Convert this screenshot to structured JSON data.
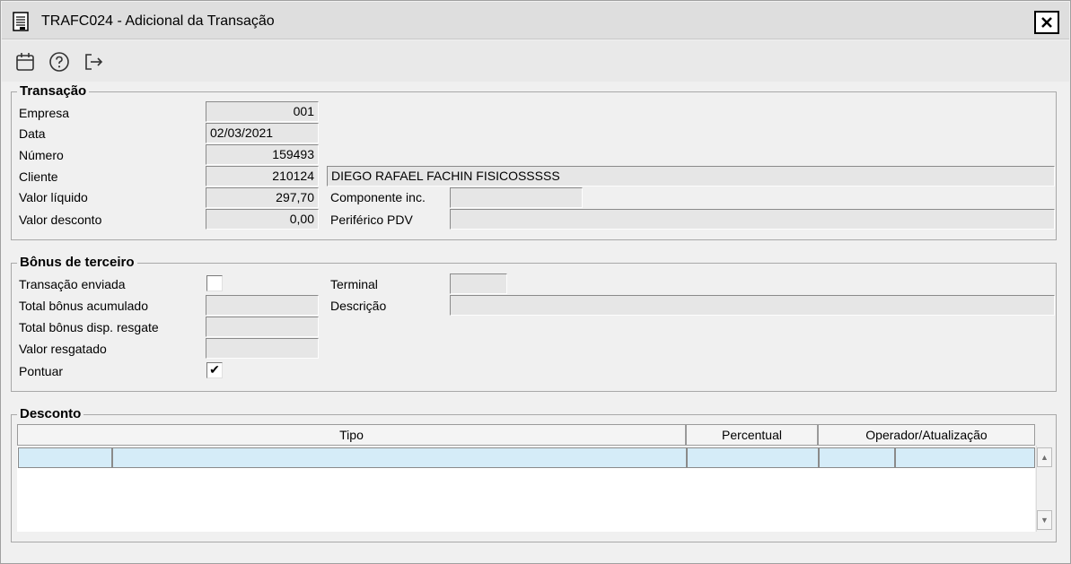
{
  "window": {
    "title": "TRAFC024 - Adicional da Transação",
    "close_label": "X"
  },
  "toolbar": {
    "icons": [
      "calendar-icon",
      "help-icon",
      "exit-icon"
    ]
  },
  "transacao": {
    "legend": "Transação",
    "empresa_label": "Empresa",
    "empresa": "001",
    "data_label": "Data",
    "data": "02/03/2021",
    "numero_label": "Número",
    "numero": "159493",
    "cliente_label": "Cliente",
    "cliente_codigo": "210124",
    "cliente_nome": "DIEGO RAFAEL FACHIN FISICOSSSSS",
    "valor_liquido_label": "Valor líquido",
    "valor_liquido": "297,70",
    "componente_label": "Componente inc.",
    "componente": "",
    "valor_desconto_label": "Valor desconto",
    "valor_desconto": "0,00",
    "periferico_label": "Periférico PDV",
    "periferico": ""
  },
  "bonus": {
    "legend": "Bônus de terceiro",
    "transacao_enviada_label": "Transação enviada",
    "transacao_enviada_checked": false,
    "terminal_label": "Terminal",
    "terminal": "",
    "total_acumulado_label": "Total bônus acumulado",
    "total_acumulado": "",
    "descricao_label": "Descrição",
    "descricao": "",
    "total_disp_label": "Total bônus disp. resgate",
    "total_disp": "",
    "valor_resgatado_label": "Valor resgatado",
    "valor_resgatado": "",
    "pontuar_label": "Pontuar",
    "pontuar_checked": true,
    "check_mark": "✔"
  },
  "desconto": {
    "legend": "Desconto",
    "columns": [
      "Tipo",
      "Percentual",
      "Operador/Atualização"
    ],
    "scroll_up": "▲",
    "scroll_down": "▼"
  },
  "colors": {
    "selected_row": "#d5ecf8",
    "field_bg": "#e6e6e6"
  }
}
